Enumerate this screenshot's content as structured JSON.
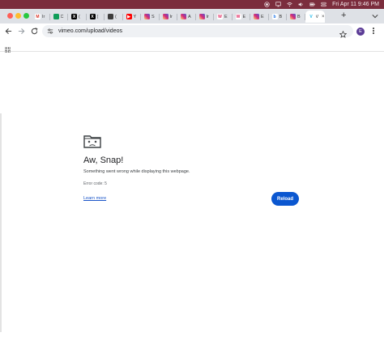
{
  "menubar": {
    "date_time": "Fri Apr 11  9:46 PM",
    "icons": [
      "record-icon",
      "cast-icon",
      "wifi-icon",
      "volume-icon",
      "battery-icon",
      "control-center-icon"
    ],
    "color": "#7b2d3d"
  },
  "tabs": [
    {
      "icon": "gmail-icon",
      "glyph": "M",
      "color": "#ffffff",
      "glyph_color": "#d93025",
      "title": "Ir"
    },
    {
      "icon": "sheets-icon",
      "glyph": "",
      "color": "#0f9d58",
      "title": "C"
    },
    {
      "icon": "x-icon",
      "glyph": "X",
      "color": "#000000",
      "title": "("
    },
    {
      "icon": "x-icon",
      "glyph": "X",
      "color": "#000000",
      "title": "("
    },
    {
      "icon": "app-icon",
      "glyph": "",
      "color": "#3c3c3c",
      "title": "("
    },
    {
      "icon": "youtube-icon",
      "glyph": "▶",
      "color": "#ff0000",
      "title": "Y"
    },
    {
      "icon": "instagram-icon",
      "glyph": "",
      "color": "#d6249f",
      "title": "S"
    },
    {
      "icon": "instagram-icon",
      "glyph": "",
      "color": "#d6249f",
      "title": "Ir"
    },
    {
      "icon": "instagram-icon",
      "glyph": "",
      "color": "#d6249f",
      "title": "A"
    },
    {
      "icon": "instagram-icon",
      "glyph": "",
      "color": "#d6249f",
      "title": "Ir"
    },
    {
      "icon": "w-icon",
      "glyph": "W",
      "color": "#ffffff",
      "glyph_color": "#e0245e",
      "title": "E"
    },
    {
      "icon": "w-icon",
      "glyph": "W",
      "color": "#ffffff",
      "glyph_color": "#e0245e",
      "title": "E"
    },
    {
      "icon": "instagram-icon",
      "glyph": "",
      "color": "#d6249f",
      "title": "E"
    },
    {
      "icon": "b-icon",
      "glyph": "b",
      "color": "#ffffff",
      "glyph_color": "#1a73e8",
      "title": "B"
    },
    {
      "icon": "instagram-icon",
      "glyph": "",
      "color": "#d6249f",
      "title": "B"
    },
    {
      "icon": "vimeo-icon",
      "glyph": "V",
      "color": "#ffffff",
      "glyph_color": "#1ab7ea",
      "title": "V",
      "active": true
    }
  ],
  "toolbar": {
    "url": "vimeo.com/upload/videos",
    "avatar_letter": "E",
    "avatar_color": "#5b3b96"
  },
  "error_page": {
    "title": "Aw, Snap!",
    "message": "Something went wrong while displaying this webpage.",
    "error_code": "Error code: 5",
    "learn_more": "Learn more",
    "reload": "Reload",
    "accent": "#0b57d0"
  }
}
